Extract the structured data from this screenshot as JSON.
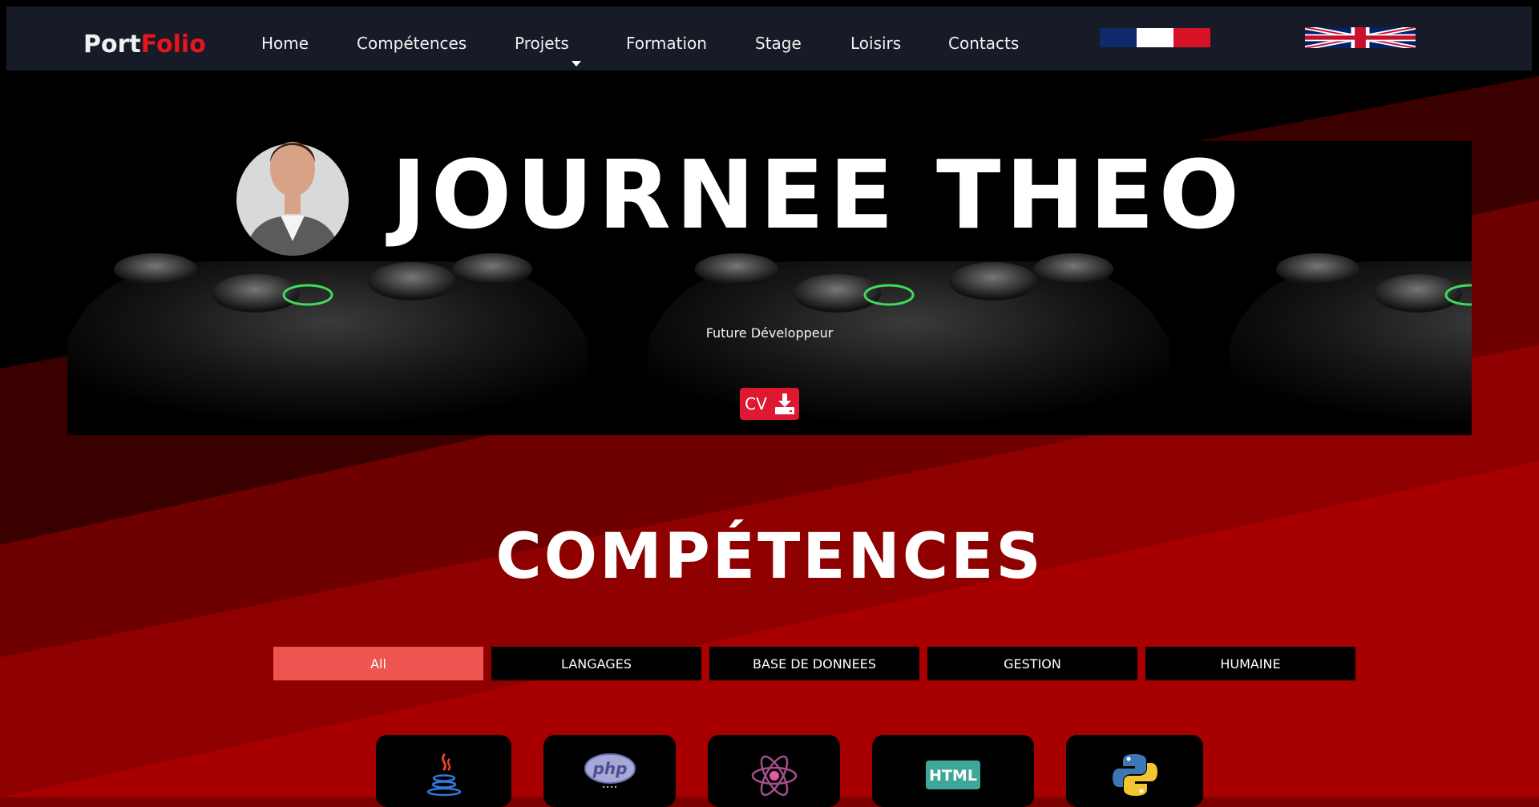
{
  "brand": {
    "part1": "Port",
    "part2": "Folio"
  },
  "nav": {
    "items": [
      {
        "label": "Home"
      },
      {
        "label": "Compétences"
      },
      {
        "label": "Projets"
      },
      {
        "label": "Formation"
      },
      {
        "label": "Stage"
      },
      {
        "label": "Loisirs"
      },
      {
        "label": "Contacts"
      }
    ],
    "languages": [
      "fr-flag-icon",
      "uk-flag-icon"
    ]
  },
  "hero": {
    "name": "JOURNEE THEO",
    "subtitle": "Future Développeur",
    "cv_label": "CV",
    "cv_icon": "download-icon"
  },
  "skills": {
    "title": "COMPÉTENCES",
    "filters": [
      {
        "label": "All",
        "active": true
      },
      {
        "label": "LANGAGES",
        "active": false
      },
      {
        "label": "BASE DE DONNEES",
        "active": false
      },
      {
        "label": "GESTION",
        "active": false
      },
      {
        "label": "HUMAINE",
        "active": false
      }
    ],
    "cards": [
      {
        "icon": "java-icon"
      },
      {
        "icon": "php-icon",
        "text": "php"
      },
      {
        "icon": "react-icon"
      },
      {
        "icon": "html-icon",
        "text": "HTML"
      },
      {
        "icon": "python-icon"
      }
    ]
  },
  "colors": {
    "navbar_bg": "#161b27",
    "brand_accent": "#e8141e",
    "cv_button": "#dd1830",
    "filter_active": "#ee5450"
  }
}
